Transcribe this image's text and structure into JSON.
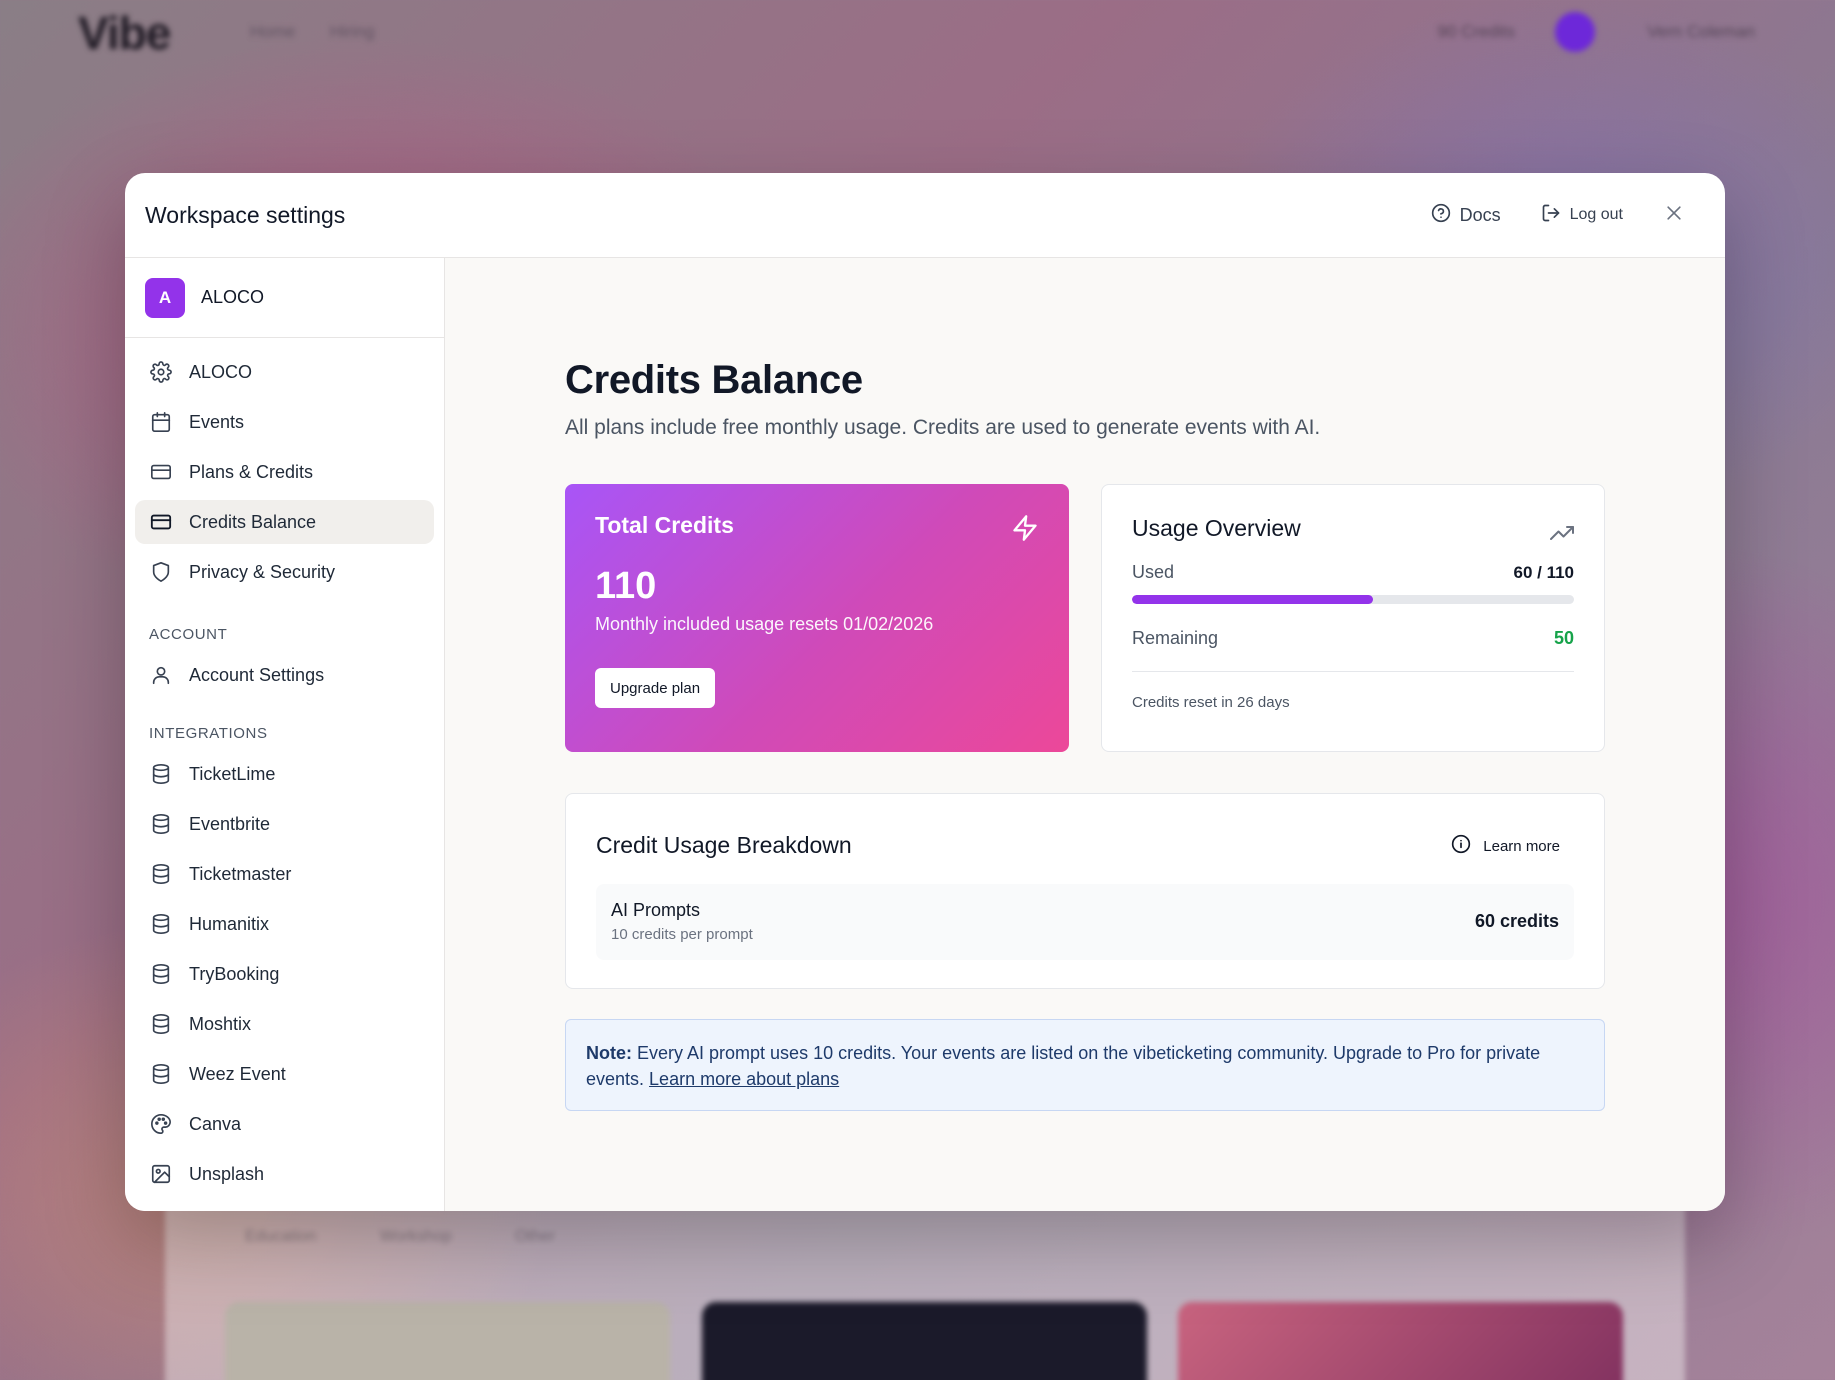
{
  "background": {
    "logo": "Vibe",
    "nav_links": [
      "Home",
      "Hiring"
    ],
    "credits": "90 Credits",
    "user": "Vern Coleman",
    "tags": [
      "Education",
      "Workshop",
      "Other"
    ]
  },
  "modal": {
    "title": "Workspace settings",
    "docs_label": "Docs",
    "logout_label": "Log out"
  },
  "sidebar": {
    "workspace_initial": "A",
    "workspace_name": "ALOCO",
    "items": [
      {
        "label": "ALOCO",
        "icon": "gear-icon"
      },
      {
        "label": "Events",
        "icon": "calendar-icon"
      },
      {
        "label": "Plans & Credits",
        "icon": "credit-card-icon"
      },
      {
        "label": "Credits Balance",
        "icon": "credit-card-icon",
        "active": true
      },
      {
        "label": "Privacy & Security",
        "icon": "shield-icon"
      }
    ],
    "account_section": "ACCOUNT",
    "account_items": [
      {
        "label": "Account Settings",
        "icon": "user-icon"
      }
    ],
    "integrations_section": "INTEGRATIONS",
    "integrations": [
      {
        "label": "TicketLime",
        "icon": "database-icon"
      },
      {
        "label": "Eventbrite",
        "icon": "database-icon"
      },
      {
        "label": "Ticketmaster",
        "icon": "database-icon"
      },
      {
        "label": "Humanitix",
        "icon": "database-icon"
      },
      {
        "label": "TryBooking",
        "icon": "database-icon"
      },
      {
        "label": "Moshtix",
        "icon": "database-icon"
      },
      {
        "label": "Weez Event",
        "icon": "database-icon"
      },
      {
        "label": "Canva",
        "icon": "palette-icon"
      },
      {
        "label": "Unsplash",
        "icon": "image-icon"
      }
    ]
  },
  "main": {
    "title": "Credits Balance",
    "subtitle": "All plans include free monthly usage. Credits are used to generate events with AI.",
    "total_credits": {
      "title": "Total Credits",
      "value": "110",
      "reset_text": "Monthly included usage resets 01/02/2026",
      "upgrade_label": "Upgrade plan"
    },
    "usage_overview": {
      "title": "Usage Overview",
      "used_label": "Used",
      "used_value": "60 / 110",
      "used_fraction": 0.545,
      "remaining_label": "Remaining",
      "remaining_value": "50",
      "footer": "Credits reset in 26 days",
      "progress_color": "#9333ea",
      "remaining_color": "#16a34a"
    },
    "breakdown": {
      "title": "Credit Usage Breakdown",
      "learn_more": "Learn more",
      "rows": [
        {
          "name": "AI Prompts",
          "desc": "10 credits per prompt",
          "value": "60 credits"
        }
      ]
    },
    "note": {
      "label": "Note:",
      "text": " Every AI prompt uses 10 credits. Your events are listed on the vibeticketing community. Upgrade to Pro for private events. ",
      "link": "Learn more about plans"
    }
  },
  "colors": {
    "accent": "#9333ea",
    "card_gradient_start": "#a855f7",
    "card_gradient_end": "#ec4899"
  }
}
